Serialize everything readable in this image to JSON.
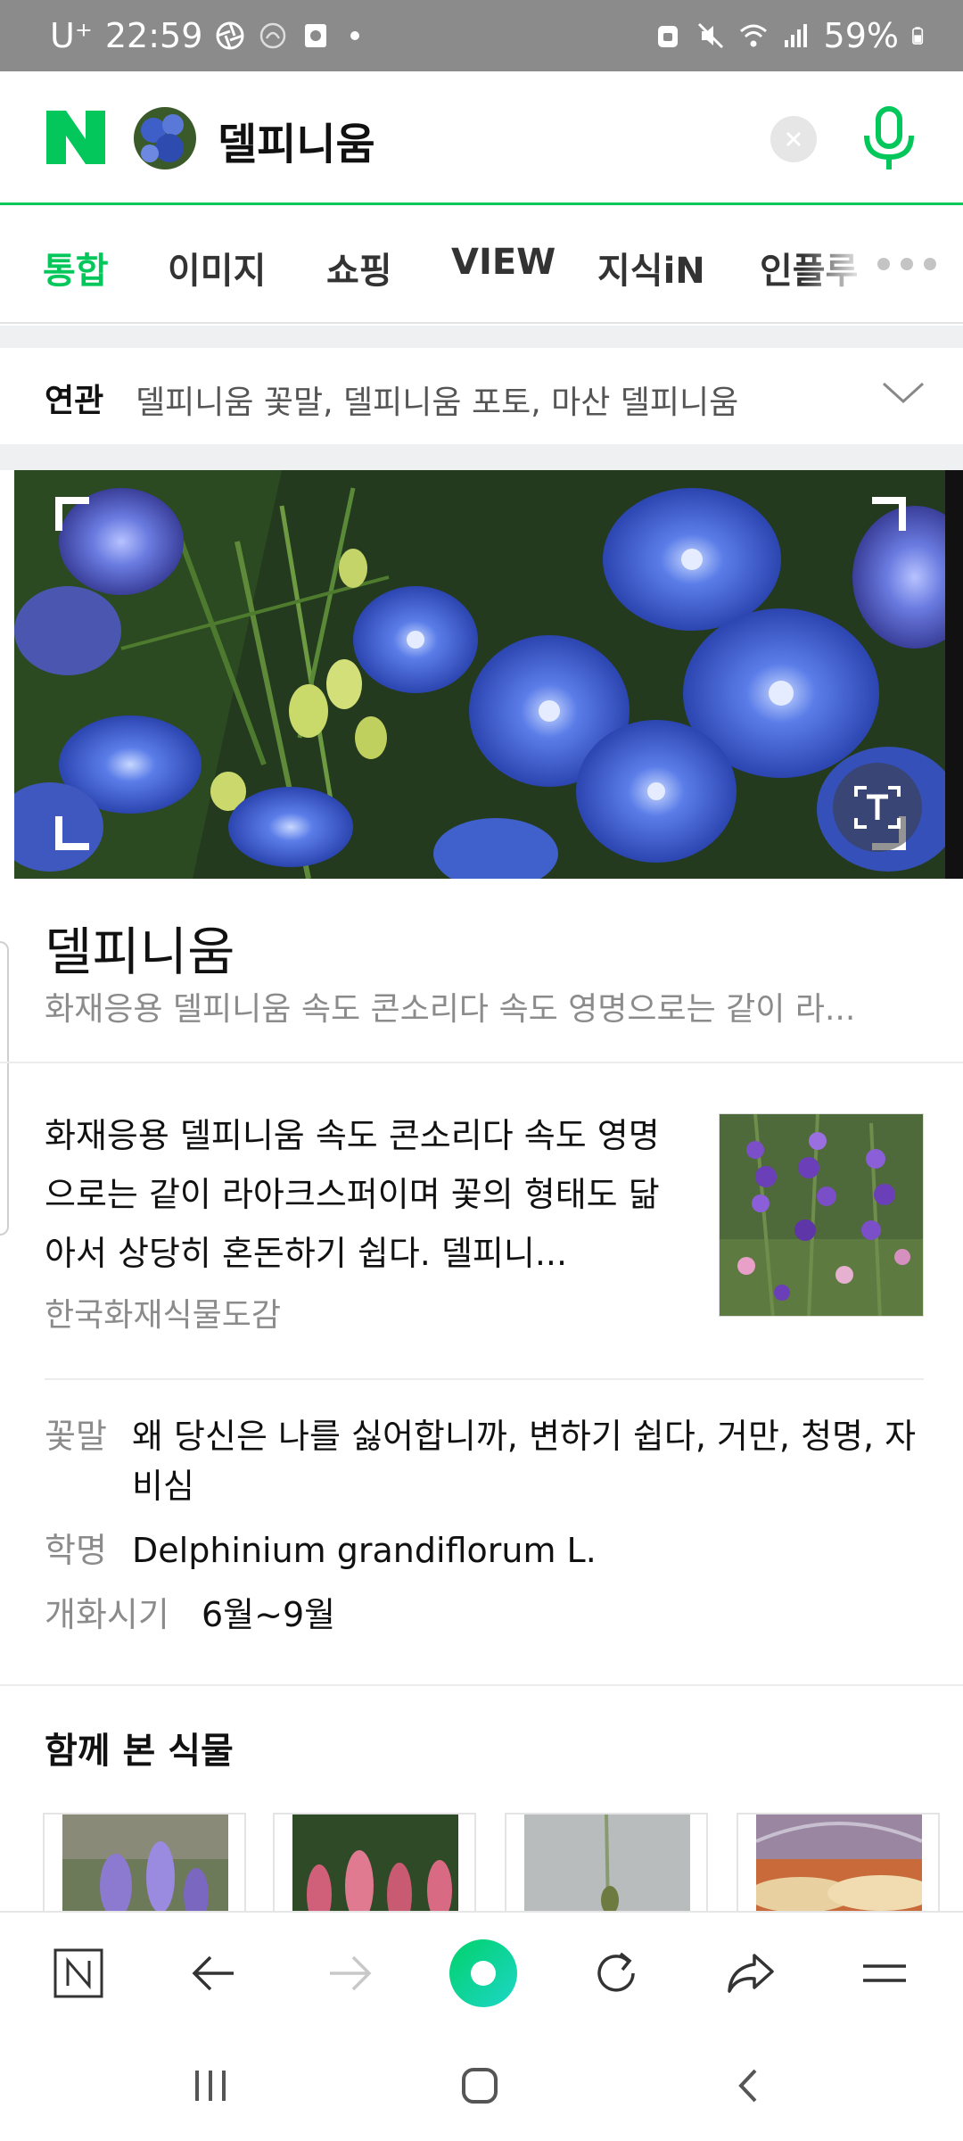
{
  "status_bar": {
    "carrier": "U⁺",
    "time": "22:59",
    "battery": "59%",
    "icons": [
      "aperture-icon",
      "app-icon",
      "notification-icon",
      "dot-icon",
      "lock-icon",
      "mute-icon",
      "wifi-icon",
      "signal-icon",
      "battery-icon"
    ]
  },
  "search": {
    "logo": "N",
    "query": "델피니움",
    "brand_color": "#03c75a"
  },
  "tabs": [
    {
      "label": "통합",
      "active": true
    },
    {
      "label": "이미지",
      "active": false
    },
    {
      "label": "쇼핑",
      "active": false
    },
    {
      "label": "VIEW",
      "active": false
    },
    {
      "label": "지식iN",
      "active": false
    },
    {
      "label": "인플루",
      "active": false
    }
  ],
  "related": {
    "label": "연관",
    "text": "델피니움 꽃말, 델피니움 포토, 마산 델피니움"
  },
  "entry": {
    "title": "델피니움",
    "subtitle": "화재응용 델피니움 속도 콘소리다 속도 영명으로는 같이 라...",
    "description": "화재응용 델피니움 속도 콘소리다 속도 영명으로는 같이 라아크스퍼이며 꽃의 형태도 닮아서 상당히 혼돈하기 쉽다. 델피니...",
    "source": "한국화재식물도감"
  },
  "info": [
    {
      "key": "꽃말",
      "value": "왜 당신은 나를 싫어합니까, 변하기 쉽다, 거만, 청명, 자비심"
    },
    {
      "key": "학명",
      "value": "Delphinium grandiflorum L."
    },
    {
      "key": "개화시기",
      "value": "6월~9월"
    }
  ],
  "related_plants": {
    "title": "함께 본 식물"
  },
  "toolbar": {
    "items": [
      "naver-home",
      "back",
      "forward",
      "green-dot",
      "refresh",
      "share",
      "menu"
    ]
  }
}
